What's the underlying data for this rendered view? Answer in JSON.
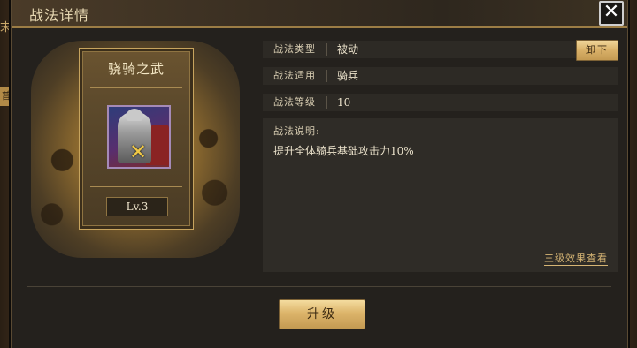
{
  "dialog": {
    "title": "战法详情",
    "close_label": "✕"
  },
  "background": {
    "left_edge_text": "末",
    "left_tab_text": "普"
  },
  "skill_card": {
    "name": "骁骑之武",
    "level": "Lv.3"
  },
  "details": {
    "rows": [
      {
        "label": "战法类型",
        "value": "被动"
      },
      {
        "label": "战法适用",
        "value": "骑兵"
      },
      {
        "label": "战法等级",
        "value": "10"
      }
    ],
    "unequip_label": "卸下"
  },
  "description": {
    "title": "战法说明:",
    "text": "提升全体骑兵基础攻击力10%",
    "link": "三级效果查看"
  },
  "footer": {
    "upgrade_label": "升级"
  },
  "colors": {
    "accent_gold": "#d9b068",
    "panel_bg": "#24211d",
    "text_light": "#ece3cc"
  }
}
